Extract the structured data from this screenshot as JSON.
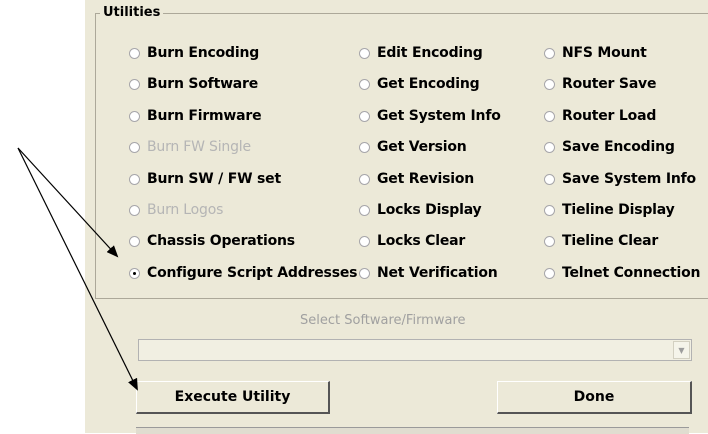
{
  "utilities_group": {
    "title": "Utilities",
    "columns": [
      [
        {
          "label": "Burn Encoding",
          "checked": false,
          "enabled": true
        },
        {
          "label": "Burn Software",
          "checked": false,
          "enabled": true
        },
        {
          "label": "Burn Firmware",
          "checked": false,
          "enabled": true
        },
        {
          "label": "Burn FW Single",
          "checked": false,
          "enabled": false
        },
        {
          "label": "Burn SW / FW set",
          "checked": false,
          "enabled": true
        },
        {
          "label": "Burn Logos",
          "checked": false,
          "enabled": false
        },
        {
          "label": "Chassis Operations",
          "checked": false,
          "enabled": true
        },
        {
          "label": "Configure Script Addresses",
          "checked": true,
          "enabled": true
        }
      ],
      [
        {
          "label": "Edit Encoding",
          "checked": false,
          "enabled": true
        },
        {
          "label": "Get Encoding",
          "checked": false,
          "enabled": true
        },
        {
          "label": "Get System Info",
          "checked": false,
          "enabled": true
        },
        {
          "label": "Get Version",
          "checked": false,
          "enabled": true
        },
        {
          "label": "Get Revision",
          "checked": false,
          "enabled": true
        },
        {
          "label": "Locks Display",
          "checked": false,
          "enabled": true
        },
        {
          "label": "Locks Clear",
          "checked": false,
          "enabled": true
        },
        {
          "label": "Net Verification",
          "checked": false,
          "enabled": true
        }
      ],
      [
        {
          "label": "NFS Mount",
          "checked": false,
          "enabled": true
        },
        {
          "label": "Router Save",
          "checked": false,
          "enabled": true
        },
        {
          "label": "Router Load",
          "checked": false,
          "enabled": true
        },
        {
          "label": "Save Encoding",
          "checked": false,
          "enabled": true
        },
        {
          "label": "Save System Info",
          "checked": false,
          "enabled": true
        },
        {
          "label": "Tieline Display",
          "checked": false,
          "enabled": true
        },
        {
          "label": "Tieline Clear",
          "checked": false,
          "enabled": true
        },
        {
          "label": "Telnet Connection",
          "checked": false,
          "enabled": true
        }
      ]
    ]
  },
  "software_select": {
    "label": "Select Software/Firmware",
    "value": ""
  },
  "buttons": {
    "execute": "Execute Utility",
    "done": "Done"
  },
  "colors": {
    "dialog_background": "#ece9d8",
    "disabled_text": "#b5b5b5",
    "annotation_arrow": "#000000"
  }
}
